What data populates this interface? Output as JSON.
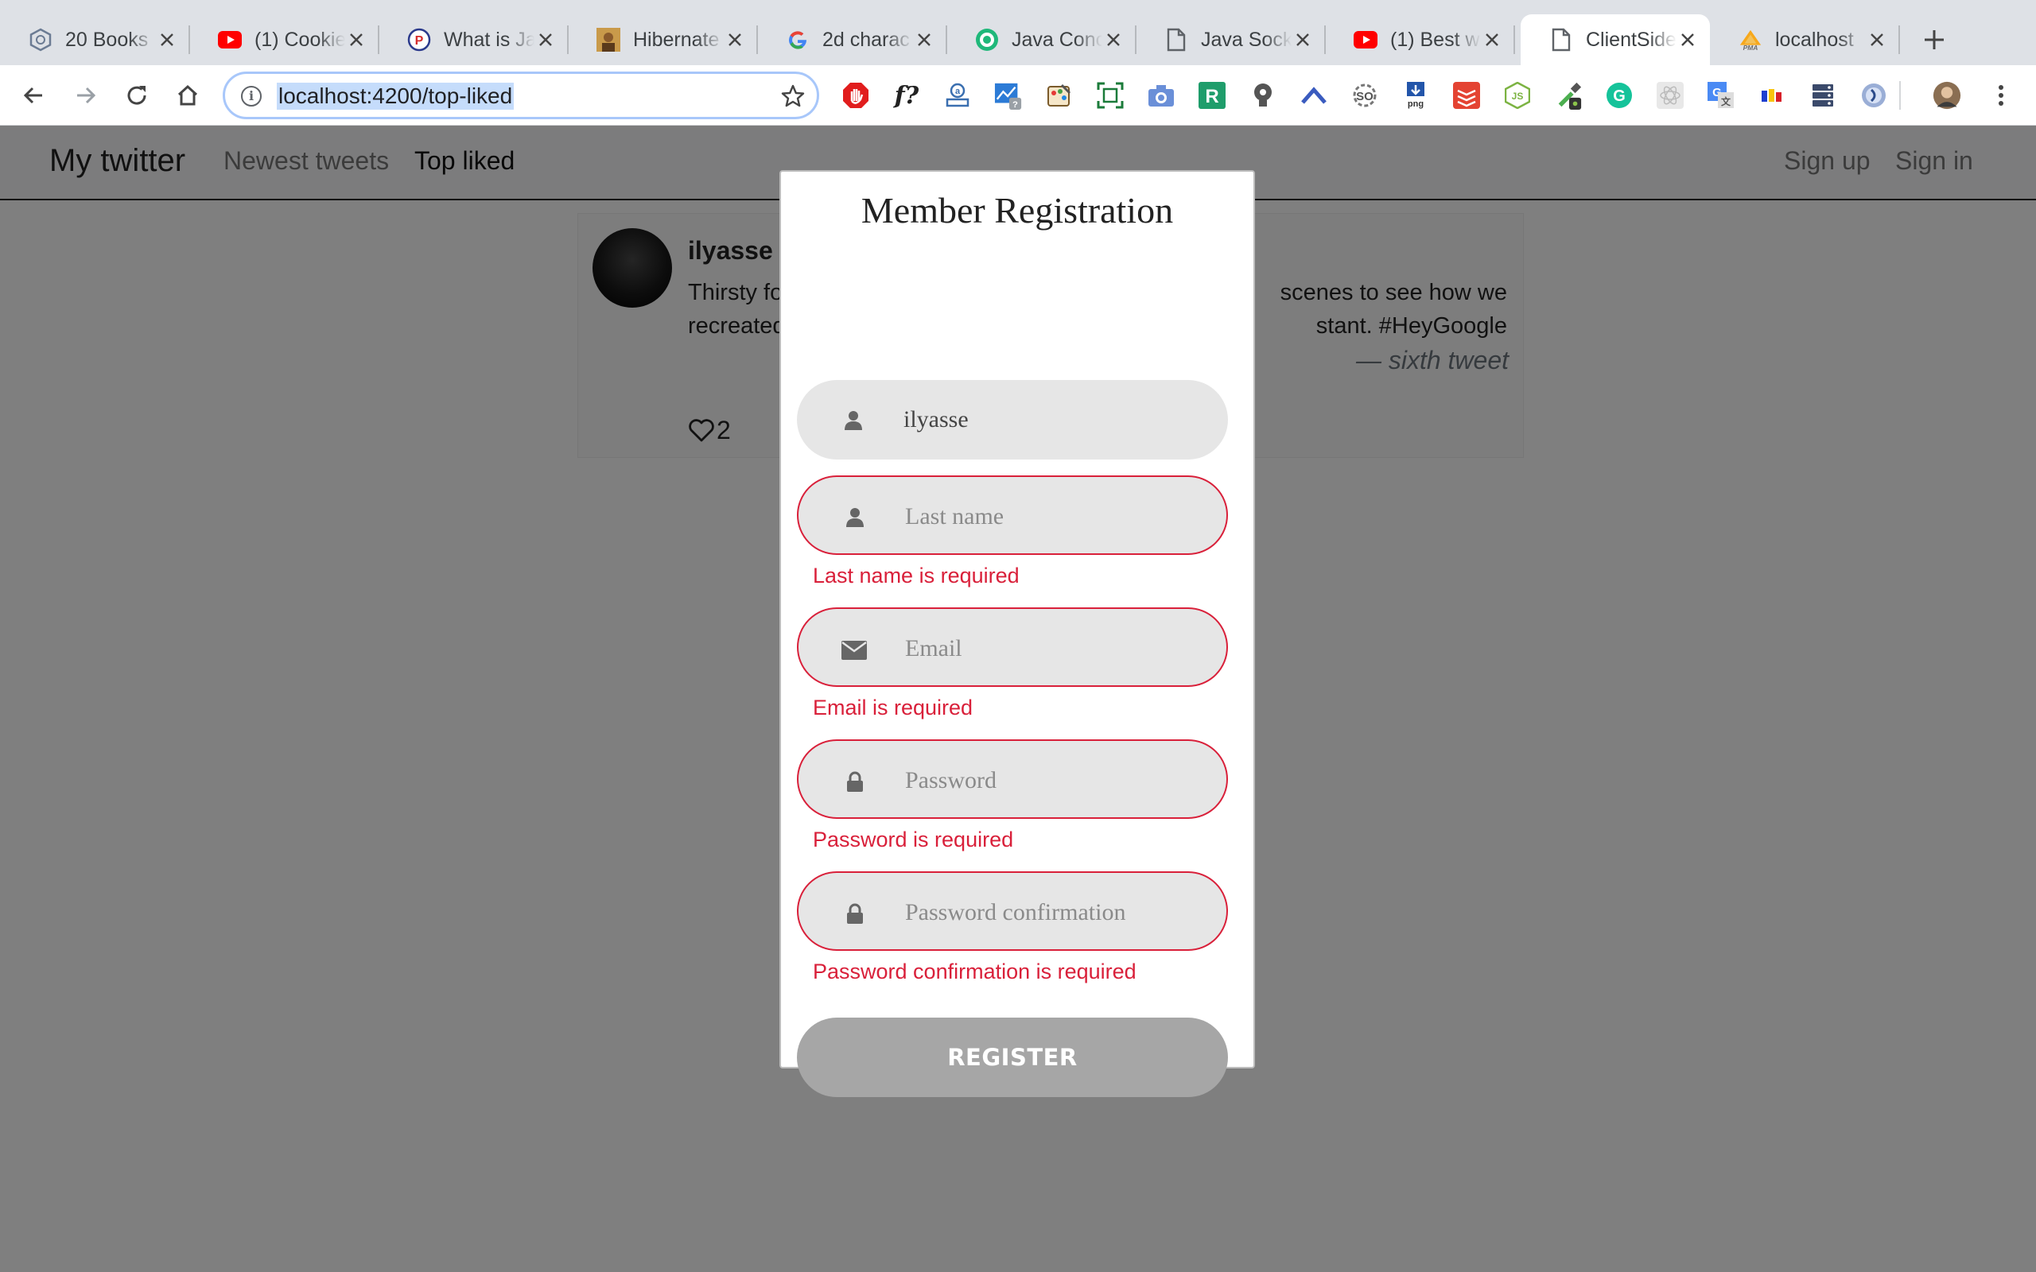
{
  "browser": {
    "tabs": [
      {
        "title": "20 Books",
        "icon": "hexagon-icon"
      },
      {
        "title": "(1) Cookie",
        "icon": "youtube-icon"
      },
      {
        "title": "What is Ja",
        "icon": "p-badge-icon"
      },
      {
        "title": "Hibernate",
        "icon": "person-photo-icon"
      },
      {
        "title": "2d charac",
        "icon": "google-icon"
      },
      {
        "title": "Java Conc",
        "icon": "green-circle-icon"
      },
      {
        "title": "Java Sock",
        "icon": "document-icon"
      },
      {
        "title": "(1) Best w",
        "icon": "youtube-icon"
      },
      {
        "title": "ClientSide",
        "icon": "document-icon"
      },
      {
        "title": "localhost",
        "icon": "pma-icon"
      }
    ],
    "active_tab_index": 8,
    "address": "localhost:4200/top-liked",
    "extensions": [
      "adblock-icon",
      "whatfont-icon",
      "extension-icon",
      "analytics-icon",
      "palette-icon",
      "screenshot-icon",
      "camera-icon",
      "r-icon",
      "bulb-icon",
      "chevron-up-icon",
      "so-icon",
      "png-icon",
      "todoist-icon",
      "nodejs-icon",
      "eyedropper-icon",
      "grammarly-icon",
      "react-icon",
      "translate-icon",
      "color-icon",
      "server-icon",
      "loop-icon",
      "profile-avatar-icon"
    ],
    "colors": {
      "tabstrip": "#dee1e6",
      "url_highlight": "#c5dcfb",
      "focus_ring": "#a8c7fa"
    }
  },
  "app": {
    "brand": "My twitter",
    "nav": {
      "newest": "Newest tweets",
      "top_liked": "Top liked",
      "sign_up": "Sign up",
      "sign_in": "Sign in"
    }
  },
  "tweet": {
    "author": "ilyasse b",
    "text_left_1": "Thirsty fo",
    "text_right_1": "scenes to see how we",
    "text_left_2": "recreated",
    "text_right_2": "stant. #HeyGoogle",
    "signature": "— sixth tweet",
    "likes": "2"
  },
  "modal": {
    "title": "Member Registration",
    "fields": [
      {
        "name": "first-name",
        "value": "ilyasse",
        "placeholder": "",
        "icon": "user-icon",
        "error": ""
      },
      {
        "name": "last-name",
        "value": "",
        "placeholder": "Last name",
        "icon": "user-icon",
        "error": "Last name is required"
      },
      {
        "name": "email",
        "value": "",
        "placeholder": "Email",
        "icon": "envelope-icon",
        "error": "Email is required"
      },
      {
        "name": "password",
        "value": "",
        "placeholder": "Password",
        "icon": "lock-icon",
        "error": "Password is required"
      },
      {
        "name": "password-confirmation",
        "value": "",
        "placeholder": "Password confirmation",
        "icon": "lock-icon",
        "error": "Password confirmation is required"
      }
    ],
    "register_label": "REGISTER",
    "colors": {
      "error": "#d9203a",
      "field_bg": "#e6e6e6",
      "button_disabled": "#a6a6a6"
    }
  }
}
